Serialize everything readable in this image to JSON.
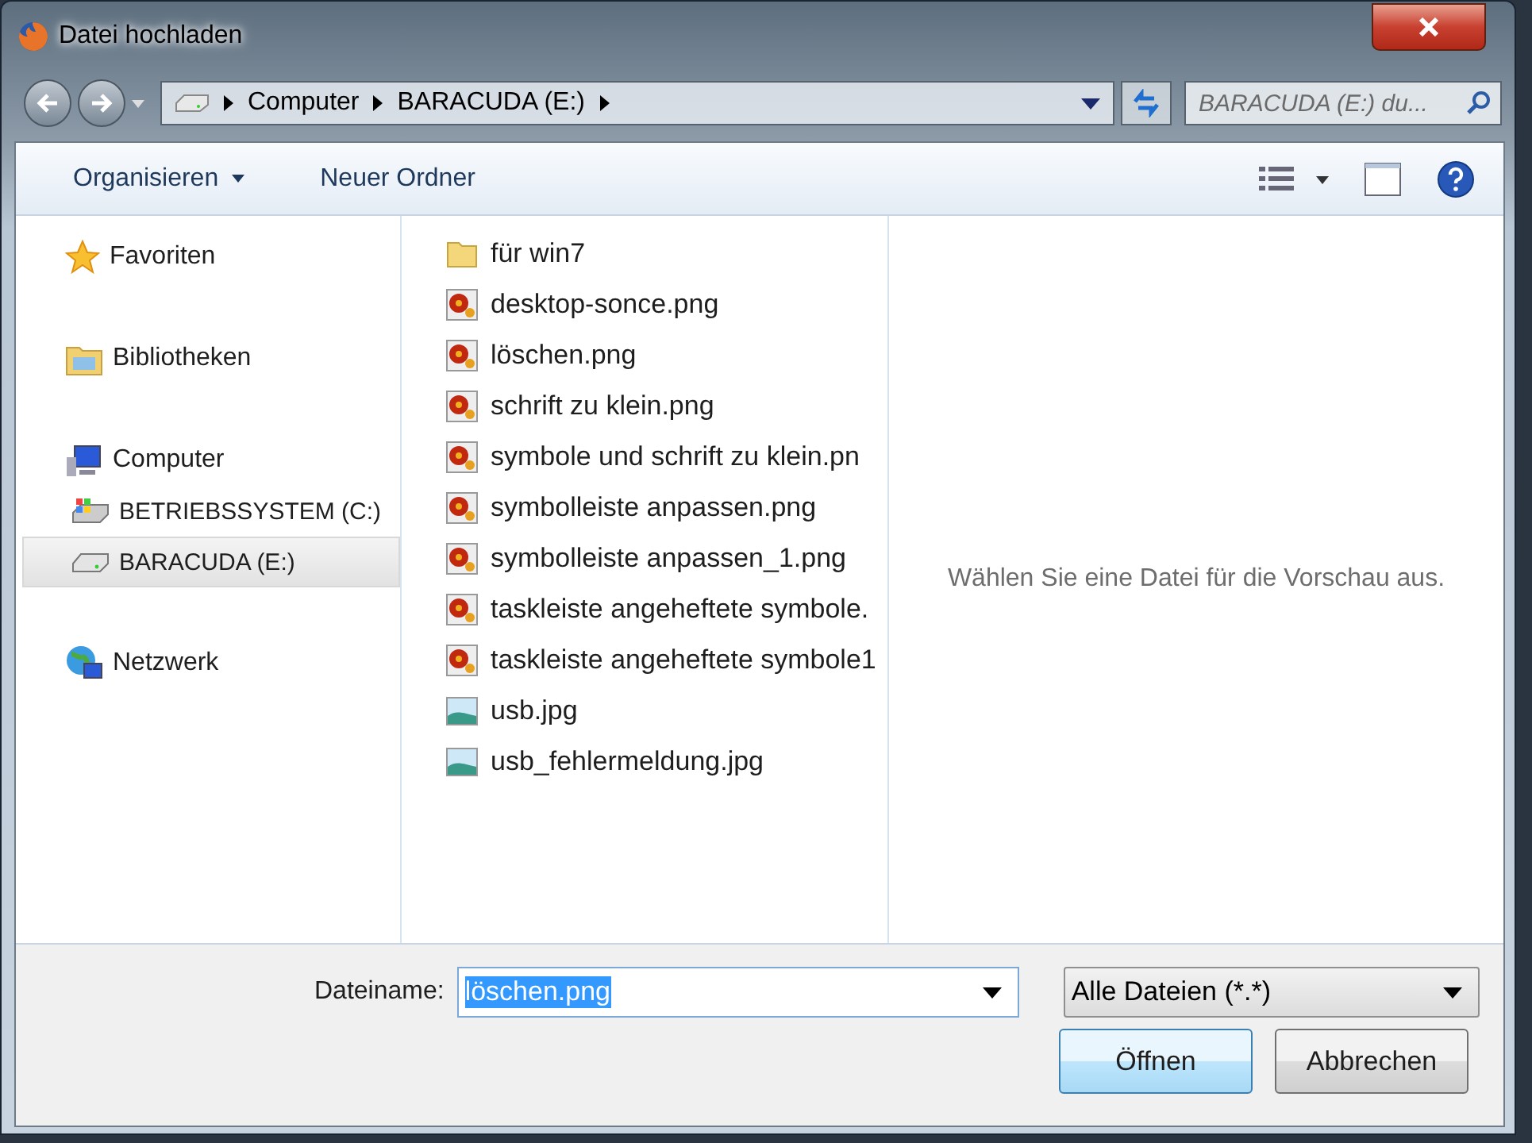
{
  "window": {
    "title": "Datei hochladen"
  },
  "address_bar": {
    "crumbs": [
      "Computer",
      "BARACUDA (E:)"
    ]
  },
  "search": {
    "placeholder": "BARACUDA (E:) du..."
  },
  "toolbar": {
    "organize": "Organisieren",
    "new_folder": "Neuer Ordner"
  },
  "sidebar": {
    "items": [
      {
        "label": "Favoriten",
        "kind": "favorites",
        "selected": false
      },
      {
        "label": "Bibliotheken",
        "kind": "libraries",
        "selected": false
      },
      {
        "label": "Computer",
        "kind": "computer",
        "selected": false,
        "children": [
          {
            "label": "BETRIEBSSYSTEM (C:)",
            "kind": "system-drive",
            "selected": false
          },
          {
            "label": "BARACUDA (E:)",
            "kind": "drive",
            "selected": true
          }
        ]
      },
      {
        "label": "Netzwerk",
        "kind": "network",
        "selected": false
      }
    ]
  },
  "files": [
    {
      "name": "für win7",
      "kind": "folder"
    },
    {
      "name": "desktop-sonce.png",
      "kind": "image"
    },
    {
      "name": "löschen.png",
      "kind": "image"
    },
    {
      "name": "schrift zu klein.png",
      "kind": "image"
    },
    {
      "name": "symbole und schrift zu klein.pn",
      "kind": "image"
    },
    {
      "name": "symbolleiste anpassen.png",
      "kind": "image"
    },
    {
      "name": "symbolleiste anpassen_1.png",
      "kind": "image"
    },
    {
      "name": "taskleiste angeheftete symbole.",
      "kind": "image"
    },
    {
      "name": "taskleiste angeheftete symbole1",
      "kind": "image"
    },
    {
      "name": "usb.jpg",
      "kind": "photo"
    },
    {
      "name": "usb_fehlermeldung.jpg",
      "kind": "photo"
    }
  ],
  "preview": {
    "message": "Wählen Sie eine Datei für die Vorschau aus."
  },
  "filename": {
    "label": "Dateiname:",
    "value": "löschen.png",
    "value_selected": true
  },
  "filetype": {
    "value": "Alle Dateien (*.*)"
  },
  "buttons": [
    {
      "label": "Öffnen",
      "default": true
    },
    {
      "label": "Abbrechen",
      "default": false
    }
  ]
}
